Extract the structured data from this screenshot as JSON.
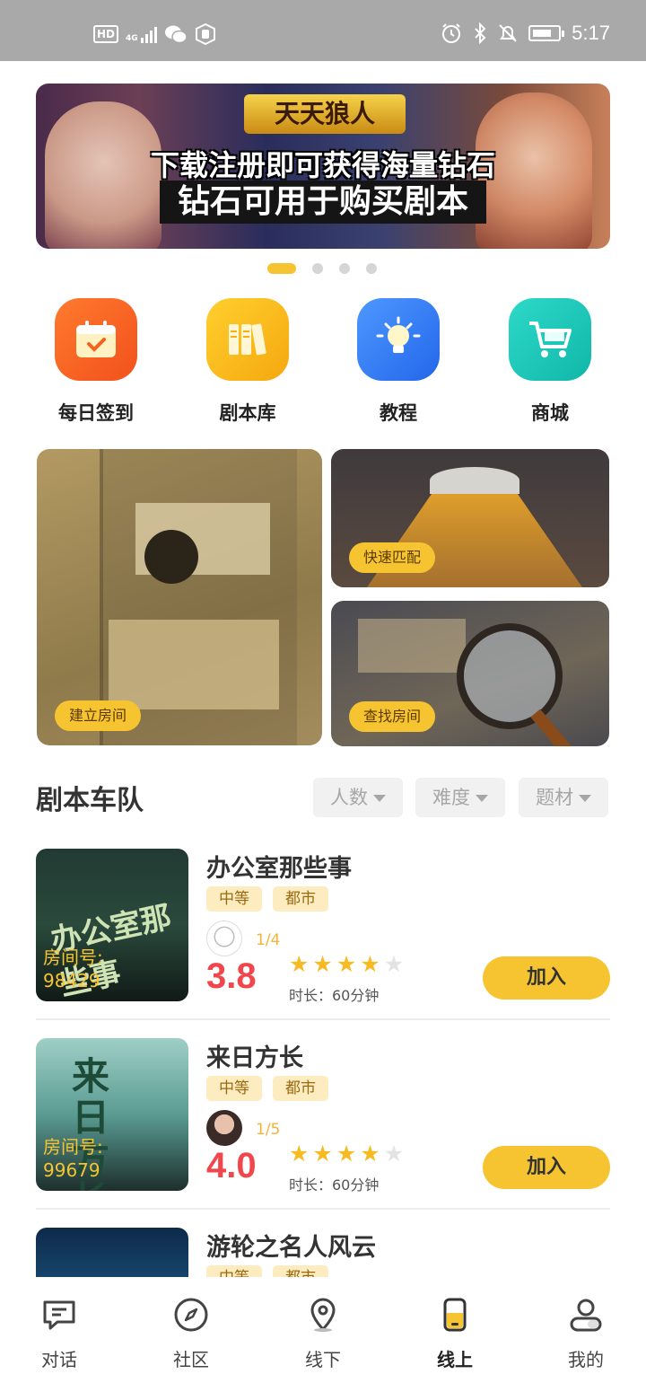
{
  "status_bar": {
    "left_icons": [
      "hd-icon",
      "signal-4g-icon",
      "wechat-icon",
      "hand-icon"
    ],
    "hd_label": "HD",
    "network_label": "4G",
    "right_icons": [
      "alarm-icon",
      "bluetooth-icon",
      "mute-bell-icon",
      "battery-icon"
    ],
    "time": "5:17"
  },
  "banner": {
    "logo_text": "天天狼人",
    "line1": "下载注册即可获得海量钻石",
    "line2": "钻石可用于购买剧本",
    "slide_count": 4,
    "active_slide": 1
  },
  "quick_menu": [
    {
      "label": "每日签到",
      "icon": "calendar-check-icon",
      "color": "#f5621f"
    },
    {
      "label": "剧本库",
      "icon": "books-icon",
      "color": "#f6b91a"
    },
    {
      "label": "教程",
      "icon": "lightbulb-icon",
      "color": "#2f7df4"
    },
    {
      "label": "商城",
      "icon": "cart-icon",
      "color": "#17c5b8"
    }
  ],
  "room_cards": {
    "create": "建立房间",
    "quick_match": "快速匹配",
    "find": "查找房间"
  },
  "section": {
    "title": "剧本车队",
    "filters": [
      "人数",
      "难度",
      "题材"
    ]
  },
  "scripts": [
    {
      "title": "办公室那些事",
      "tags": [
        "中等",
        "都市"
      ],
      "room_label": "房间号:",
      "room_no": "98429",
      "players": "1/4",
      "score": "3.8",
      "stars": 4,
      "duration": "时长：60分钟",
      "join": "加入"
    },
    {
      "title": "来日方长",
      "tags": [
        "中等",
        "都市"
      ],
      "room_label": "房间号:",
      "room_no": "99679",
      "players": "1/5",
      "score": "4.0",
      "stars": 4,
      "duration": "时长：60分钟",
      "join": "加入"
    },
    {
      "title": "游轮之名人风云",
      "tags": [
        "中等",
        "都市"
      ]
    }
  ],
  "bottom_nav": [
    {
      "label": "对话",
      "icon": "chat-icon"
    },
    {
      "label": "社区",
      "icon": "compass-icon"
    },
    {
      "label": "线下",
      "icon": "location-pin-icon"
    },
    {
      "label": "线上",
      "icon": "phone-icon",
      "active": true
    },
    {
      "label": "我的",
      "icon": "user-icon"
    }
  ]
}
